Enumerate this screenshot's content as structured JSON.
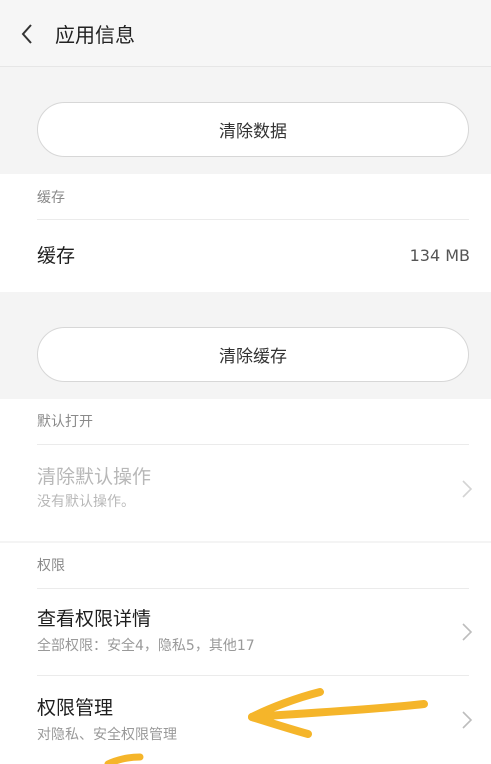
{
  "header": {
    "title": "应用信息"
  },
  "storage": {
    "clear_data_label": "清除数据"
  },
  "cache": {
    "section_title": "缓存",
    "row_label": "缓存",
    "row_value": "134 MB",
    "clear_cache_label": "清除缓存"
  },
  "default_open": {
    "section_title": "默认打开",
    "item_title": "清除默认操作",
    "item_subtitle": "没有默认操作。"
  },
  "permissions": {
    "section_title": "权限",
    "items": [
      {
        "title": "查看权限详情",
        "subtitle": "全部权限：安全4，隐私5，其他17"
      },
      {
        "title": "权限管理",
        "subtitle": "对隐私、安全权限管理"
      }
    ]
  },
  "colors": {
    "annotation": "#f5b52a",
    "background": "#f4f4f4"
  }
}
